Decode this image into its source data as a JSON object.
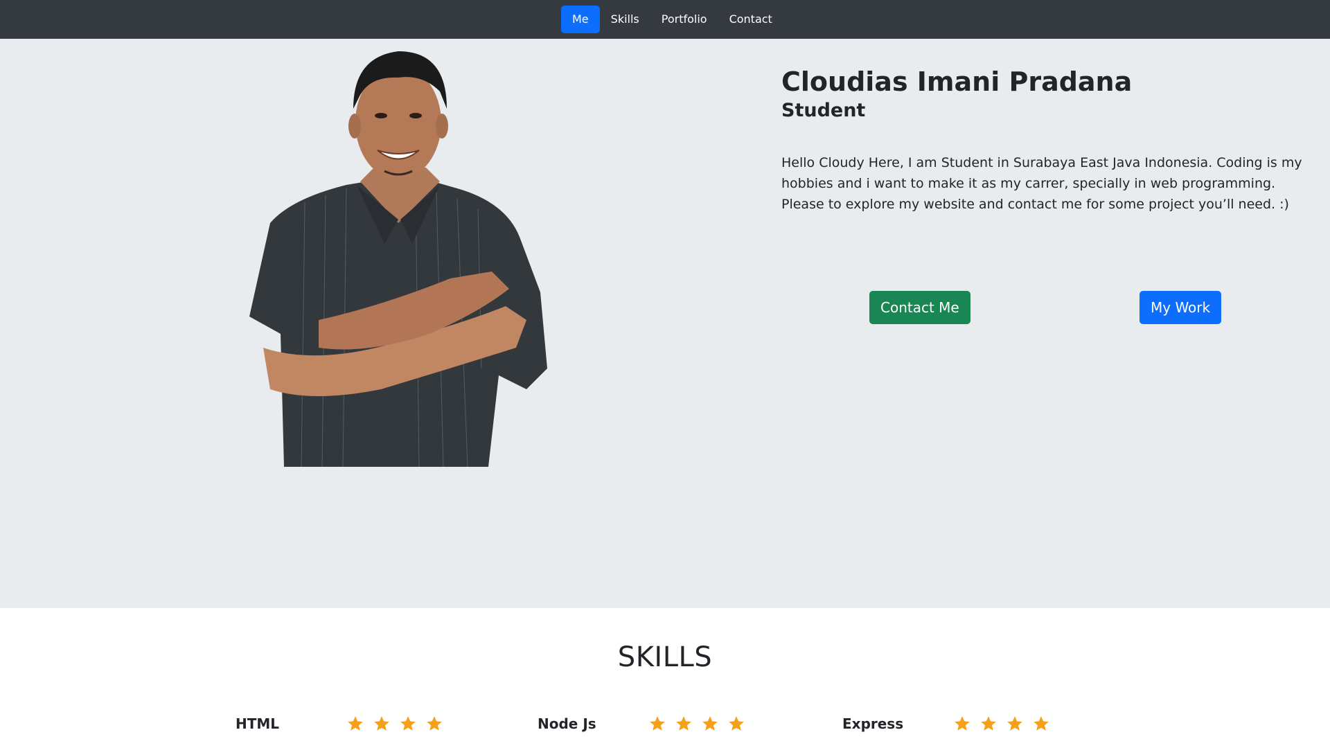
{
  "nav": {
    "items": [
      {
        "label": "Me",
        "active": true
      },
      {
        "label": "Skills",
        "active": false
      },
      {
        "label": "Portfolio",
        "active": false
      },
      {
        "label": "Contact",
        "active": false
      }
    ]
  },
  "hero": {
    "name": "Cloudias Imani Pradana",
    "role": "Student",
    "description": "Hello Cloudy Here, I am Student in Surabaya East Java Indonesia. Coding is my hobbies and i want to make it as my carrer, specially in web programming. Please to explore my website and contact me for some project you’ll need. :)",
    "contact_button": "Contact Me",
    "work_button": "My Work"
  },
  "skills": {
    "title": "SKILLS",
    "items": [
      {
        "name": "HTML",
        "stars": 4
      },
      {
        "name": "Node Js",
        "stars": 4
      },
      {
        "name": "Express",
        "stars": 4
      }
    ]
  },
  "colors": {
    "navbar": "#343a40",
    "accent_blue": "#0d6efd",
    "accent_green": "#198754",
    "hero_bg": "#e9ecef",
    "star": "#f6a01a"
  }
}
